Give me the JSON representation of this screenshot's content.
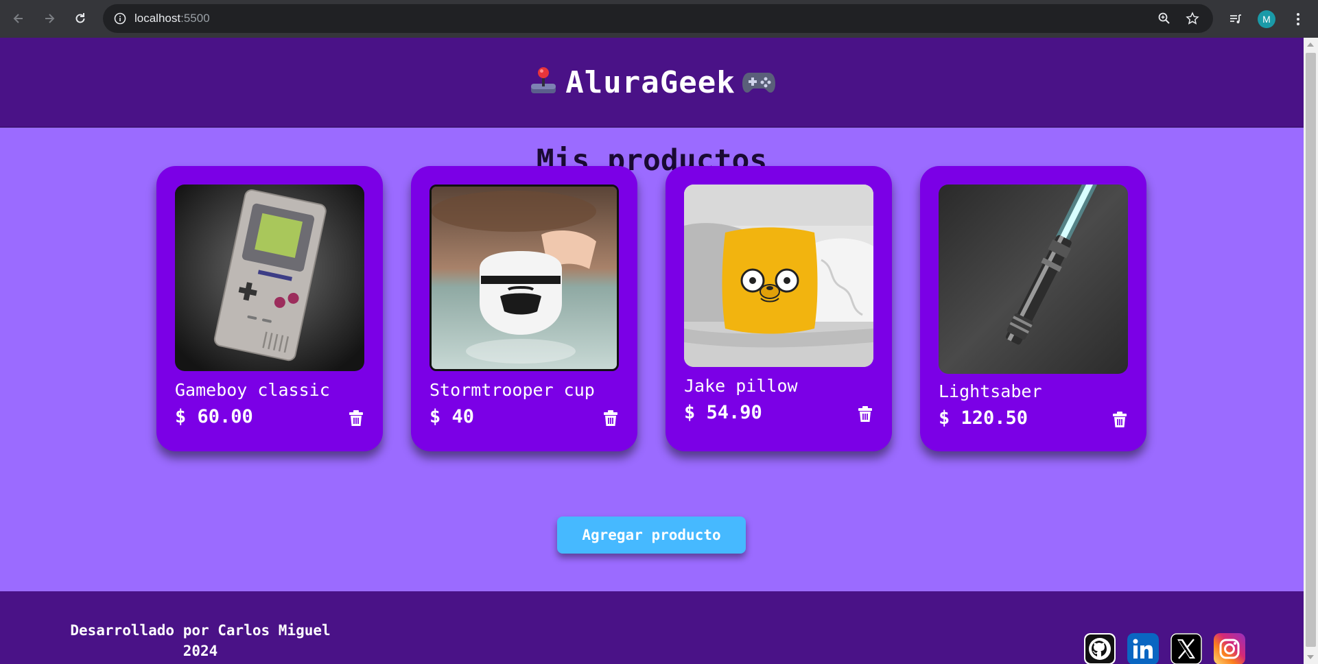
{
  "browser": {
    "url_host": "localhost",
    "url_port": ":5500",
    "profile_initial": "M"
  },
  "header": {
    "title": "AluraGeek",
    "left_icon": "joystick-icon",
    "right_icon": "gamepad-icon"
  },
  "main": {
    "section_title": "Mis productos",
    "products": [
      {
        "name": "Gameboy classic",
        "price": "$ 60.00",
        "image": "gameboy-image"
      },
      {
        "name": "Stormtrooper cup",
        "price": "$ 40",
        "image": "stormtrooper-cup-image"
      },
      {
        "name": "Jake pillow",
        "price": "$ 54.90",
        "image": "jake-pillow-image"
      },
      {
        "name": "Lightsaber",
        "price": "$ 120.50",
        "image": "lightsaber-image"
      }
    ],
    "add_button_label": "Agregar producto"
  },
  "footer": {
    "credit_line1": "Desarrollado por Carlos Miguel",
    "credit_line2": "2024",
    "social": [
      "github-icon",
      "linkedin-icon",
      "x-icon",
      "instagram-icon"
    ]
  },
  "colors": {
    "header_bg": "#4a1287",
    "page_bg": "#9b6bff",
    "card_bg": "#7b00e6",
    "button_bg": "#46b9ff"
  }
}
